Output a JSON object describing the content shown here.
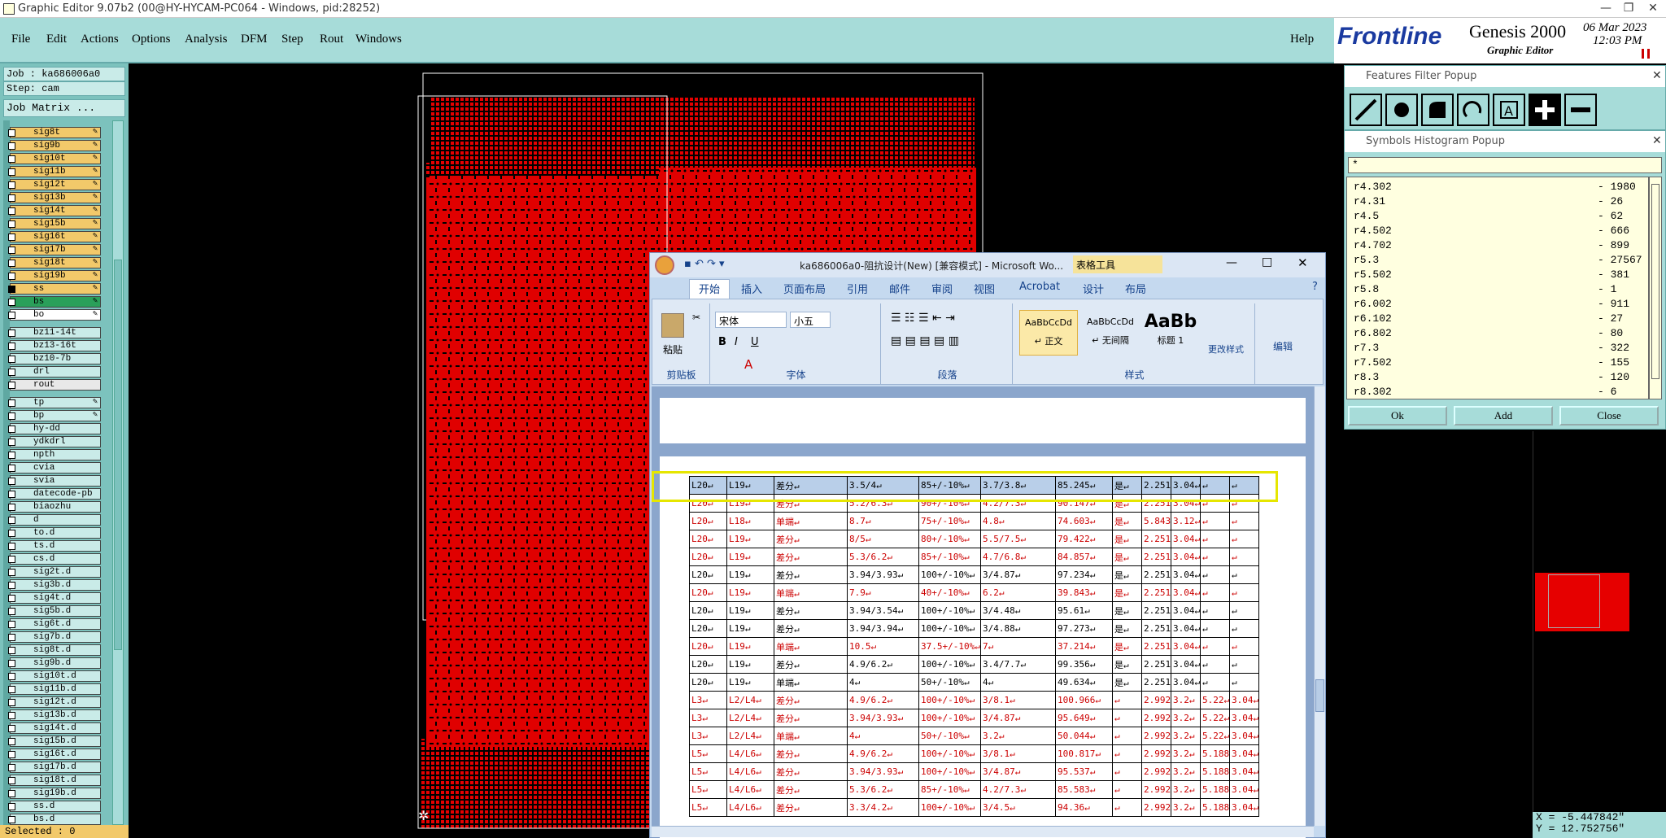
{
  "window": {
    "title": "Graphic Editor 9.07b2 (00@HY-HYCAM-PC064 - Windows, pid:28252)"
  },
  "menu": [
    "File",
    "Edit",
    "Actions",
    "Options",
    "Analysis",
    "DFM",
    "Step",
    "Rout",
    "Windows"
  ],
  "help": "Help",
  "brand": {
    "logo": "Frontline",
    "product": "Genesis 2000",
    "sub": "Graphic Editor",
    "date": "06 Mar 2023",
    "time": "12:03 PM"
  },
  "job": {
    "job": "Job : ka686006a0",
    "step": "Step: cam",
    "matrix": "Job Matrix ..."
  },
  "layers": [
    {
      "n": "sig8t",
      "c": "#f2c96a"
    },
    {
      "n": "sig9b",
      "c": "#f2c96a"
    },
    {
      "n": "sig10t",
      "c": "#f2c96a"
    },
    {
      "n": "sig11b",
      "c": "#f2c96a"
    },
    {
      "n": "sig12t",
      "c": "#f2c96a"
    },
    {
      "n": "sig13b",
      "c": "#f2c96a"
    },
    {
      "n": "sig14t",
      "c": "#f2c96a"
    },
    {
      "n": "sig15b",
      "c": "#f2c96a"
    },
    {
      "n": "sig16t",
      "c": "#f2c96a"
    },
    {
      "n": "sig17b",
      "c": "#f2c96a"
    },
    {
      "n": "sig18t",
      "c": "#f2c96a"
    },
    {
      "n": "sig19b",
      "c": "#f2c96a"
    },
    {
      "n": "ss",
      "c": "#f2c96a",
      "sel": true
    },
    {
      "n": "bs",
      "c": "#2aa05a"
    },
    {
      "n": "bo",
      "c": "#ffffff"
    },
    {
      "n": "bz11-14t",
      "c": "#c9ebe8"
    },
    {
      "n": "bz13-16t",
      "c": "#c9ebe8"
    },
    {
      "n": "bz10-7b",
      "c": "#c9ebe8"
    },
    {
      "n": "drl",
      "c": "#c9ebe8"
    },
    {
      "n": "rout",
      "c": "#e8e8e8"
    },
    {
      "n": "tp",
      "c": "#c9ebe8"
    },
    {
      "n": "bp",
      "c": "#c9ebe8"
    },
    {
      "n": "hy-dd",
      "c": "#c9ebe8"
    },
    {
      "n": "ydkdrl",
      "c": "#c9ebe8"
    },
    {
      "n": "npth",
      "c": "#c9ebe8"
    },
    {
      "n": "cvia",
      "c": "#c9ebe8"
    },
    {
      "n": "svia",
      "c": "#c9ebe8"
    },
    {
      "n": "datecode-pb",
      "c": "#c9ebe8"
    },
    {
      "n": "biaozhu",
      "c": "#c9ebe8"
    },
    {
      "n": "d",
      "c": "#c9ebe8"
    },
    {
      "n": "to.d",
      "c": "#c9ebe8"
    },
    {
      "n": "ts.d",
      "c": "#c9ebe8"
    },
    {
      "n": "cs.d",
      "c": "#c9ebe8"
    },
    {
      "n": "sig2t.d",
      "c": "#c9ebe8"
    },
    {
      "n": "sig3b.d",
      "c": "#c9ebe8"
    },
    {
      "n": "sig4t.d",
      "c": "#c9ebe8"
    },
    {
      "n": "sig5b.d",
      "c": "#c9ebe8"
    },
    {
      "n": "sig6t.d",
      "c": "#c9ebe8"
    },
    {
      "n": "sig7b.d",
      "c": "#c9ebe8"
    },
    {
      "n": "sig8t.d",
      "c": "#c9ebe8"
    },
    {
      "n": "sig9b.d",
      "c": "#c9ebe8"
    },
    {
      "n": "sig10t.d",
      "c": "#c9ebe8"
    },
    {
      "n": "sig11b.d",
      "c": "#c9ebe8"
    },
    {
      "n": "sig12t.d",
      "c": "#c9ebe8"
    },
    {
      "n": "sig13b.d",
      "c": "#c9ebe8"
    },
    {
      "n": "sig14t.d",
      "c": "#c9ebe8"
    },
    {
      "n": "sig15b.d",
      "c": "#c9ebe8"
    },
    {
      "n": "sig16t.d",
      "c": "#c9ebe8"
    },
    {
      "n": "sig17b.d",
      "c": "#c9ebe8"
    },
    {
      "n": "sig18t.d",
      "c": "#c9ebe8"
    },
    {
      "n": "sig19b.d",
      "c": "#c9ebe8"
    },
    {
      "n": "ss.d",
      "c": "#c9ebe8"
    },
    {
      "n": "bs.d",
      "c": "#c9ebe8"
    }
  ],
  "status": "Selected : 0",
  "word": {
    "title": "ka686006a0-阻抗设计(New) [兼容模式] - Microsoft Wo...",
    "context_tab": "表格工具",
    "tabs": [
      "开始",
      "插入",
      "页面布局",
      "引用",
      "邮件",
      "审阅",
      "视图",
      "Acrobat",
      "设计",
      "布局"
    ],
    "font": "宋体",
    "size": "小五",
    "groups": [
      "剪贴板",
      "字体",
      "段落",
      "样式"
    ],
    "paste": "粘贴",
    "styles": [
      {
        "p": "AaBbCcDd",
        "l": "↵ 正文"
      },
      {
        "p": "AaBbCcDd",
        "l": "↵ 无间隔"
      },
      {
        "p": "AaBb",
        "l": "标题 1"
      }
    ],
    "change_styles": "更改样式",
    "edit": "编辑",
    "rows": [
      [
        "L20↵",
        "L19↵",
        "差分↵",
        "3.5/4↵",
        "85+/-10%↵",
        "3.7/3.8↵",
        "85.245↵",
        "是↵",
        "2.251↵",
        "3.04↵",
        "↵",
        "↵"
      ],
      [
        "L20↵",
        "L19↵",
        "差分↵",
        "5.2/6.3↵",
        "90+/-10%↵",
        "4.2/7.3↵",
        "90.147↵",
        "是↵",
        "2.251↵",
        "3.04↵",
        "↵",
        "↵"
      ],
      [
        "L20↵",
        "L18↵",
        "单端↵",
        "8.7↵",
        "75+/-10%↵",
        "4.8↵",
        "74.603↵",
        "是↵",
        "5.843↵",
        "3.12↵",
        "↵",
        "↵"
      ],
      [
        "L20↵",
        "L19↵",
        "差分↵",
        "8/5↵",
        "80+/-10%↵",
        "5.5/7.5↵",
        "79.422↵",
        "是↵",
        "2.251↵",
        "3.04↵",
        "↵",
        "↵"
      ],
      [
        "L20↵",
        "L19↵",
        "差分↵",
        "5.3/6.2↵",
        "85+/-10%↵",
        "4.7/6.8↵",
        "84.857↵",
        "是↵",
        "2.251↵",
        "3.04↵",
        "↵",
        "↵"
      ],
      [
        "L20↵",
        "L19↵",
        "差分↵",
        "3.94/3.93↵",
        "100+/-10%↵",
        "3/4.87↵",
        "97.234↵",
        "是↵",
        "2.251↵",
        "3.04↵",
        "↵",
        "↵"
      ],
      [
        "L20↵",
        "L19↵",
        "单端↵",
        "7.9↵",
        "40+/-10%↵",
        "6.2↵",
        "39.843↵",
        "是↵",
        "2.251↵",
        "3.04↵",
        "↵",
        "↵"
      ],
      [
        "L20↵",
        "L19↵",
        "差分↵",
        "3.94/3.54↵",
        "100+/-10%↵",
        "3/4.48↵",
        "95.61↵",
        "是↵",
        "2.251↵",
        "3.04↵",
        "↵",
        "↵"
      ],
      [
        "L20↵",
        "L19↵",
        "差分↵",
        "3.94/3.94↵",
        "100+/-10%↵",
        "3/4.88↵",
        "97.273↵",
        "是↵",
        "2.251↵",
        "3.04↵",
        "↵",
        "↵"
      ],
      [
        "L20↵",
        "L19↵",
        "单端↵",
        "10.5↵",
        "37.5+/-10%↵",
        "7↵",
        "37.214↵",
        "是↵",
        "2.251↵",
        "3.04↵",
        "↵",
        "↵"
      ],
      [
        "L20↵",
        "L19↵",
        "差分↵",
        "4.9/6.2↵",
        "100+/-10%↵",
        "3.4/7.7↵",
        "99.356↵",
        "是↵",
        "2.251↵",
        "3.04↵",
        "↵",
        "↵"
      ],
      [
        "L20↵",
        "L19↵",
        "单端↵",
        "4↵",
        "50+/-10%↵",
        "4↵",
        "49.634↵",
        "是↵",
        "2.251↵",
        "3.04↵",
        "↵",
        "↵"
      ],
      [
        "L3↵",
        "L2/L4↵",
        "差分↵",
        "4.9/6.2↵",
        "100+/-10%↵",
        "3/8.1↵",
        "100.966↵",
        "↵",
        "2.992↵",
        "3.2↵",
        "5.22↵",
        "3.04↵"
      ],
      [
        "L3↵",
        "L2/L4↵",
        "差分↵",
        "3.94/3.93↵",
        "100+/-10%↵",
        "3/4.87↵",
        "95.649↵",
        "↵",
        "2.992↵",
        "3.2↵",
        "5.22↵",
        "3.04↵"
      ],
      [
        "L3↵",
        "L2/L4↵",
        "单端↵",
        "4↵",
        "50+/-10%↵",
        "3.2↵",
        "50.044↵",
        "↵",
        "2.992↵",
        "3.2↵",
        "5.22↵",
        "3.04↵"
      ],
      [
        "L5↵",
        "L4/L6↵",
        "差分↵",
        "4.9/6.2↵",
        "100+/-10%↵",
        "3/8.1↵",
        "100.817↵",
        "↵",
        "2.992↵",
        "3.2↵",
        "5.188↵",
        "3.04↵"
      ],
      [
        "L5↵",
        "L4/L6↵",
        "差分↵",
        "3.94/3.93↵",
        "100+/-10%↵",
        "3/4.87↵",
        "95.537↵",
        "↵",
        "2.992↵",
        "3.2↵",
        "5.188↵",
        "3.04↵"
      ],
      [
        "L5↵",
        "L4/L6↵",
        "差分↵",
        "5.3/6.2↵",
        "85+/-10%↵",
        "4.2/7.3↵",
        "85.583↵",
        "↵",
        "2.992↵",
        "3.2↵",
        "5.188↵",
        "3.04↵"
      ],
      [
        "L5↵",
        "L4/L6↵",
        "差分↵",
        "3.3/4.2↵",
        "100+/-10%↵",
        "3/4.5↵",
        "94.36↵",
        "↵",
        "2.992↵",
        "3.2↵",
        "5.188↵",
        "3.04↵"
      ]
    ],
    "row_colors": [
      "#000",
      "#c00",
      "#c00",
      "#c00",
      "#c00",
      "#000",
      "#c00",
      "#000",
      "#000",
      "#c00",
      "#000",
      "#000",
      "#c00",
      "#c00",
      "#c00",
      "#c00",
      "#c00",
      "#c00",
      "#c00"
    ]
  },
  "filter_popup": {
    "title": "Features Filter Popup"
  },
  "histogram": {
    "title": "Symbols Histogram Popup",
    "filter": "*",
    "items": [
      [
        "r4.302",
        "- 1980"
      ],
      [
        "r4.31",
        "- 26"
      ],
      [
        "r4.5",
        "- 62"
      ],
      [
        "r4.502",
        "- 666"
      ],
      [
        "r4.702",
        "- 899"
      ],
      [
        "r5.3",
        "- 27567"
      ],
      [
        "r5.502",
        "- 381"
      ],
      [
        "r5.8",
        "- 1"
      ],
      [
        "r6.002",
        "- 911"
      ],
      [
        "r6.102",
        "- 27"
      ],
      [
        "r6.802",
        "- 80"
      ],
      [
        "r7.3",
        "- 322"
      ],
      [
        "r7.502",
        "- 155"
      ],
      [
        "r8.3",
        "- 120"
      ],
      [
        "r8.302",
        "- 6"
      ]
    ],
    "buttons": [
      "Ok",
      "Add",
      "Close"
    ]
  },
  "coords": {
    "x": "X = -5.447842\"",
    "y": "Y = 12.752756\""
  },
  "colors": {
    "accent": "#a7dcd9",
    "copper": "#ff0000",
    "highlight": "#e6e600"
  }
}
